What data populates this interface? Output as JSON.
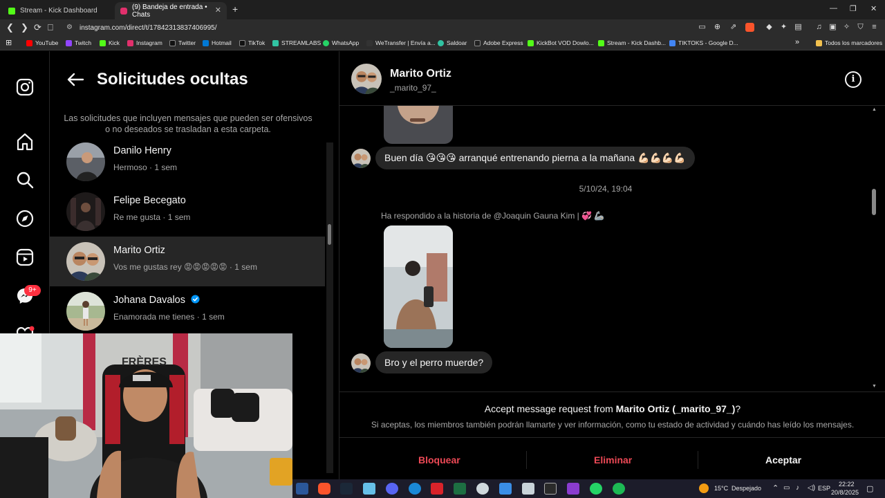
{
  "browser": {
    "tabs": [
      {
        "label": "Stream - Kick Dashboard",
        "color": "#53fc18"
      },
      {
        "label": "(9) Bandeja de entrada • Chats",
        "color": "#e1306c"
      }
    ],
    "new_tab": "+",
    "url": "instagram.com/direct/t/17842313837406995/",
    "bookmarks": [
      {
        "label": "YouTube",
        "color": "#ff0000"
      },
      {
        "label": "Twitch",
        "color": "#9146ff"
      },
      {
        "label": "Kick",
        "color": "#53fc18"
      },
      {
        "label": "Instagram",
        "color": "#e1306c"
      },
      {
        "label": "Twitter",
        "color": "#111111"
      },
      {
        "label": "Hotmail",
        "color": "#0078d4"
      },
      {
        "label": "TikTok",
        "color": "#111111"
      },
      {
        "label": "STREAMLABS",
        "color": "#31c3a2"
      },
      {
        "label": "WhatsApp",
        "color": "#25d366"
      },
      {
        "label": "WeTransfer | Envía a...",
        "color": "#333333"
      },
      {
        "label": "Saldoar",
        "color": "#31c3a2"
      },
      {
        "label": "Adobe Express",
        "color": "#222222"
      },
      {
        "label": "KickBot VOD Dowlo...",
        "color": "#53fc18"
      },
      {
        "label": "Stream - Kick Dashb...",
        "color": "#53fc18"
      },
      {
        "label": "TIKTOKS - Google D...",
        "color": "#4285f4"
      }
    ],
    "bookmarks_more": "»",
    "all_bookmarks": "Todos los marcadores"
  },
  "sidebar": {
    "badge": "9+"
  },
  "requests": {
    "title": "Solicitudes ocultas",
    "note": "Las solicitudes que incluyen mensajes que pueden ser ofensivos o no deseados se trasladan a esta carpeta.",
    "items": [
      {
        "name": "Danilo Henry",
        "preview": "Hermoso · 1 sem"
      },
      {
        "name": "Felipe Becegato",
        "preview": "Re me gusta · 1 sem"
      },
      {
        "name": "Marito Ortiz",
        "preview": "Vos me gustas rey 😡😡😡😡😡 · 1 sem"
      },
      {
        "name": "Johana Davalos",
        "preview": "Enamorada me tienes · 1 sem"
      }
    ]
  },
  "chat": {
    "name": "Marito Ortiz",
    "username": "_marito_97_",
    "messages": [
      {
        "text": "Buen día 😘😘😘 arranqué entrenando pierna a la mañana 💪🏻💪🏻💪🏻💪🏻"
      },
      {
        "text": "Bro y el perro muerde?"
      }
    ],
    "timestamp": "5/10/24, 19:04",
    "story_reply": "Ha respondido a la historia de @Joaquin Gauna Kim | 💞 🦾",
    "accept_prefix": "Accept message request from ",
    "accept_name": "Marito Ortiz (_marito_97_)",
    "accept_suffix": "?",
    "accept_note": "Si aceptas, los miembros también podrán llamarte y ver información, como tu estado de actividad y cuándo has leído los mensajes.",
    "block_label": "Bloquear",
    "delete_label": "Eliminar",
    "accept_label": "Aceptar",
    "danger_color": "#ed4956"
  },
  "webcam": {
    "wall_text": "FRÈRES"
  },
  "taskbar": {
    "weather_temp": "15°C",
    "weather_desc": "Despejado",
    "lang": "ESP",
    "time": "22:22",
    "date": "20/8/2025"
  }
}
